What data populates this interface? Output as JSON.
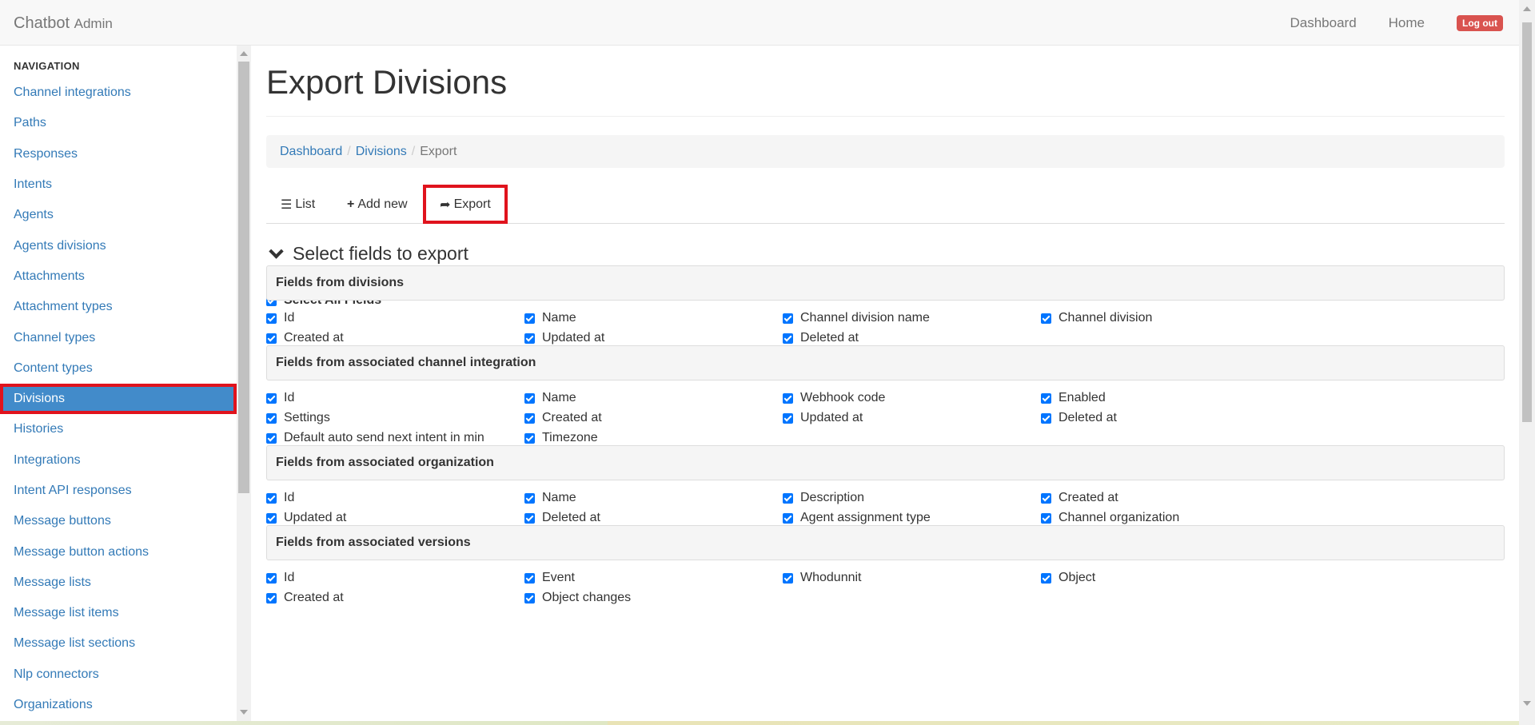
{
  "navbar": {
    "brand": "Chatbot",
    "brand_sub": "Admin",
    "links": [
      "Dashboard",
      "Home"
    ],
    "logout": "Log out"
  },
  "sidebar": {
    "header": "NAVIGATION",
    "items": [
      {
        "label": "Channel integrations"
      },
      {
        "label": "Paths"
      },
      {
        "label": "Responses"
      },
      {
        "label": "Intents"
      },
      {
        "label": "Agents"
      },
      {
        "label": "Agents divisions"
      },
      {
        "label": "Attachments"
      },
      {
        "label": "Attachment types"
      },
      {
        "label": "Channel types"
      },
      {
        "label": "Content types"
      },
      {
        "label": "Divisions",
        "active": true
      },
      {
        "label": "Histories"
      },
      {
        "label": "Integrations"
      },
      {
        "label": "Intent API responses"
      },
      {
        "label": "Message buttons"
      },
      {
        "label": "Message button actions"
      },
      {
        "label": "Message lists"
      },
      {
        "label": "Message list items"
      },
      {
        "label": "Message list sections"
      },
      {
        "label": "Nlp connectors"
      },
      {
        "label": "Organizations"
      }
    ]
  },
  "main": {
    "title": "Export Divisions",
    "breadcrumb": {
      "items": [
        "Dashboard",
        "Divisions"
      ],
      "current": "Export"
    },
    "tabs": [
      {
        "label": "List",
        "icon": "list-icon"
      },
      {
        "label": "Add new",
        "icon": "plus-icon"
      },
      {
        "label": "Export",
        "icon": "share-icon",
        "active": true
      }
    ],
    "section_title": "Select fields to export",
    "select_all": "Select All Fields",
    "groups": [
      {
        "title": "Fields from divisions",
        "fields": [
          "Id",
          "Name",
          "Channel division name",
          "Channel division",
          "Created at",
          "Updated at",
          "Deleted at"
        ]
      },
      {
        "title": "Fields from associated channel integration",
        "fields": [
          "Id",
          "Name",
          "Webhook code",
          "Enabled",
          "Settings",
          "Created at",
          "Updated at",
          "Deleted at",
          "Default auto send next intent in min",
          "Timezone"
        ]
      },
      {
        "title": "Fields from associated organization",
        "fields": [
          "Id",
          "Name",
          "Description",
          "Created at",
          "Updated at",
          "Deleted at",
          "Agent assignment type",
          "Channel organization"
        ]
      },
      {
        "title": "Fields from associated versions",
        "fields": [
          "Id",
          "Event",
          "Whodunnit",
          "Object",
          "Created at",
          "Object changes"
        ]
      }
    ]
  },
  "colors": {
    "accent": "#337ab7",
    "active_bg": "#428bca",
    "highlight": "#e0131d",
    "logout": "#d9534f",
    "checkbox": "#0075ff"
  }
}
